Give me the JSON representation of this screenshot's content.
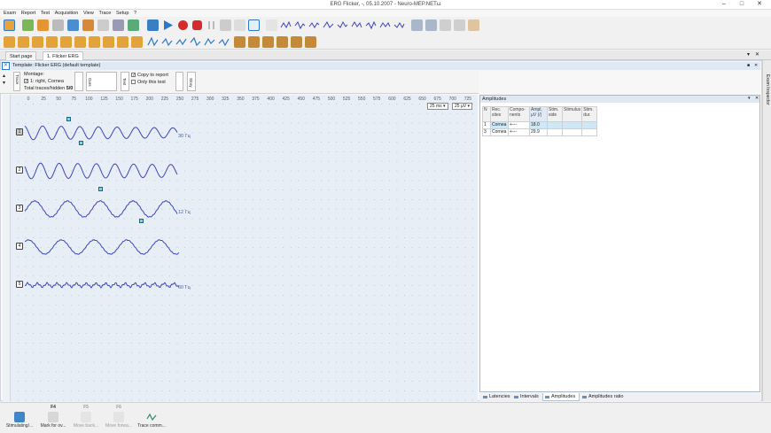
{
  "window": {
    "title": "ERG Flicker, -, 05.10.2007 - Neuro-MEP.NETω",
    "min": "‒",
    "max": "□",
    "close": "✕"
  },
  "menu": [
    "Exam",
    "Report",
    "Test",
    "Acquisition",
    "View",
    "Trace",
    "Setup",
    "?"
  ],
  "tabs": [
    {
      "label": "Start page",
      "active": false
    },
    {
      "label": "1. Flicker ERG",
      "active": true
    }
  ],
  "template": {
    "title": "Template: Flicker ERG (default template)",
    "montage_label": "Montage:",
    "montage_value": "1: right, Cornea",
    "montage_checked": true,
    "total_label": "Total traces/hidden",
    "total_value": "5/0",
    "copy_to_report": "Copy to report",
    "copy_checked": true,
    "only_this_test": "Only this test",
    "only_checked": false,
    "side_tabs": [
      "Trace",
      "Curs",
      "Test",
      "Story"
    ]
  },
  "plot": {
    "x_ticks": [
      "0",
      "25",
      "50",
      "75",
      "100",
      "125",
      "150",
      "175",
      "200",
      "225",
      "250",
      "275",
      "300",
      "325",
      "350",
      "375",
      "400",
      "425",
      "450",
      "475",
      "500",
      "525",
      "550",
      "575",
      "600",
      "625",
      "650",
      "675",
      "700",
      "725"
    ],
    "sweep": "25 ms",
    "sensitivity": "25 µV",
    "traces": [
      {
        "id": "1",
        "selected": true,
        "speed": "30 Гц"
      },
      {
        "id": "2",
        "selected": false,
        "speed": ""
      },
      {
        "id": "3",
        "selected": false,
        "speed": "12 Гц"
      },
      {
        "id": "4",
        "selected": false,
        "speed": ""
      },
      {
        "id": "5",
        "selected": false,
        "speed": "60 Гц"
      }
    ]
  },
  "amplitudes": {
    "title": "Amplitudes",
    "columns": [
      "N",
      "Rec. sites",
      "Compo-nents",
      "Ampl, µV (/)",
      "Stim. side",
      "Stimulus",
      "Stim. dur."
    ],
    "rows": [
      [
        "1",
        "Cornea",
        "+---",
        "18.0",
        "",
        "",
        ""
      ],
      [
        "3",
        "Cornea",
        "+---",
        "29.9",
        "",
        "",
        ""
      ]
    ],
    "bottom_tabs": [
      {
        "label": "Latencies",
        "active": false
      },
      {
        "label": "Intervals",
        "active": false
      },
      {
        "label": "Amplitudes",
        "active": true
      },
      {
        "label": "Amplitudes ratio",
        "active": false
      }
    ]
  },
  "side_panel": {
    "label": "Exam Inspector"
  },
  "status_buttons": [
    {
      "key": "",
      "label": "Stimulating/...",
      "disabled": false
    },
    {
      "key": "F4",
      "label": "Mark for ov...",
      "disabled": false
    },
    {
      "key": "F5",
      "label": "Move back...",
      "disabled": true
    },
    {
      "key": "F6",
      "label": "Move forwa...",
      "disabled": true
    },
    {
      "key": "",
      "label": "Trace comm...",
      "disabled": false
    }
  ],
  "colors": {
    "trace": "#3b47b8",
    "accent_blue": "#2b78c8",
    "record_red": "#d62b2b",
    "highlight_cell": "#cfe8f5"
  }
}
